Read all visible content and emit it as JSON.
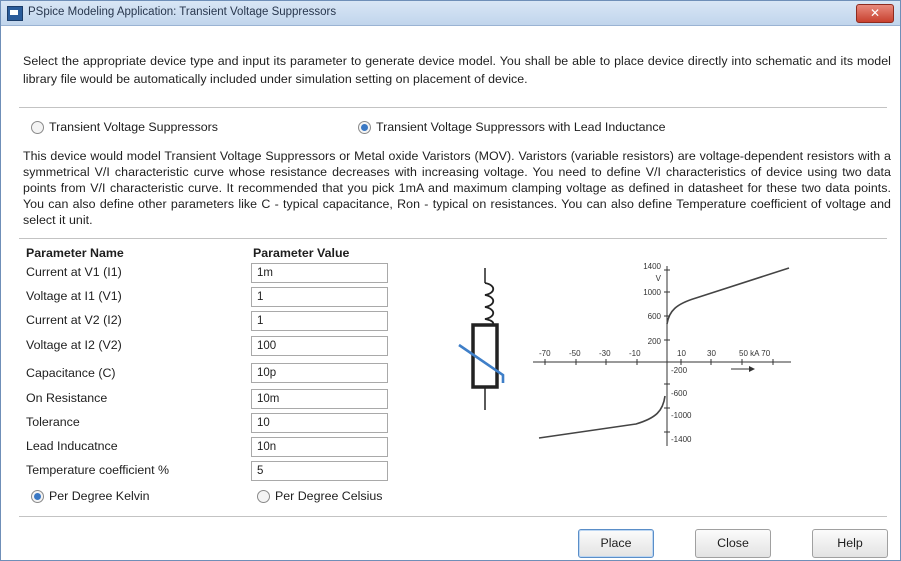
{
  "window": {
    "title": "PSpice Modeling Application: Transient Voltage Suppressors",
    "close_icon": "close-icon"
  },
  "intro_text": "Select the appropriate device type and input its parameter to generate device model. You shall be able to place device directly into schematic and its model library file would be automatically included under simulation setting on placement of device.",
  "device_type": {
    "options": [
      {
        "label": "Transient Voltage Suppressors",
        "selected": false
      },
      {
        "label": "Transient Voltage Suppressors with Lead Inductance",
        "selected": true
      }
    ]
  },
  "description": "This device would model Transient Voltage Suppressors or Metal oxide Varistors (MOV). Varistors (variable resistors) are voltage-dependent resistors with a symmetrical V/I characteristic curve whose resistance decreases with increasing voltage. You need to define V/I characteristics of device using two data points from V/I characteristic curve. It recommended that you pick 1mA and maximum clamping voltage as defined in datasheet for these two data points. You can also define other parameters like C - typical capacitance, Ron - typical on resistances. You can also define Temperature coefficient of voltage and select it unit.",
  "parameters": {
    "name_header": "Parameter Name",
    "value_header": "Parameter Value",
    "rows": [
      {
        "name": "Current at V1 (I1)",
        "value": "1m"
      },
      {
        "name": "Voltage at I1 (V1)",
        "value": "1"
      },
      {
        "name": "Current at V2 (I2)",
        "value": "1"
      },
      {
        "name": "Voltage at I2 (V2)",
        "value": "100"
      },
      {
        "name": "Capacitance (C)",
        "value": "10p"
      },
      {
        "name": "On Resistance",
        "value": "10m"
      },
      {
        "name": "Tolerance",
        "value": "10"
      },
      {
        "name": "Lead Inducatnce",
        "value": "10n"
      },
      {
        "name": "Temperature coefficient %",
        "value": "5"
      }
    ]
  },
  "temp_unit": {
    "options": [
      {
        "label": "Per Degree Kelvin",
        "selected": true
      },
      {
        "label": "Per Degree Celsius",
        "selected": false
      }
    ]
  },
  "chart": {
    "axis_label": "V",
    "y_ticks": [
      "1400",
      "1000",
      "600",
      "200",
      "-200",
      "-600",
      "-1000",
      "-1400"
    ],
    "x_ticks_neg": [
      "-70",
      "-50",
      "-30",
      "-10"
    ],
    "x_ticks_pos": [
      "10",
      "30",
      "50 kA 70"
    ]
  },
  "buttons": {
    "place": "Place",
    "close": "Close",
    "help": "Help"
  },
  "colors": {
    "title_bar": "#c8daf0",
    "radio_selected": "#3a78c4",
    "symbol_accent": "#3f7fc8"
  }
}
